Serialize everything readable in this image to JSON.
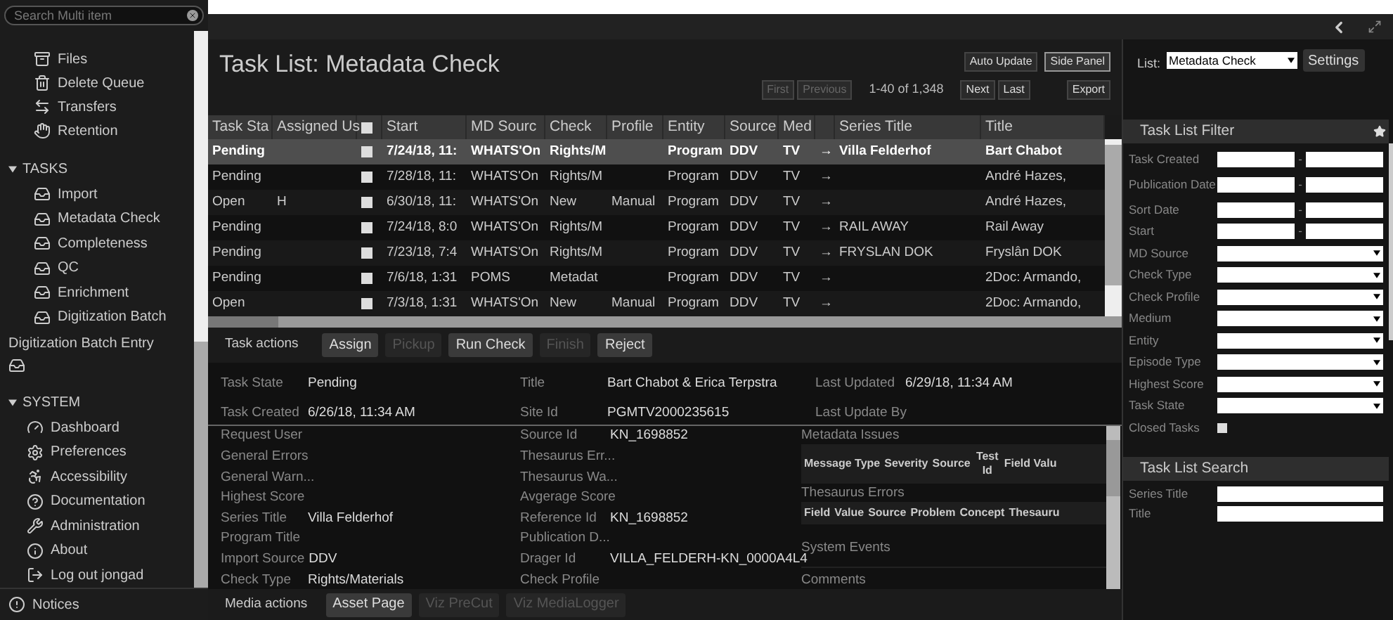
{
  "sidebar": {
    "search": {
      "placeholder": "Search Multi item"
    },
    "top_items": [
      {
        "label": "Files"
      },
      {
        "label": "Delete Queue"
      },
      {
        "label": "Transfers"
      },
      {
        "label": "Retention"
      }
    ],
    "sections": [
      {
        "title": "TASKS",
        "expanded": true,
        "items": [
          {
            "label": "Import"
          },
          {
            "label": "Metadata Check"
          },
          {
            "label": "Completeness"
          },
          {
            "label": "QC"
          },
          {
            "label": "Enrichment"
          },
          {
            "label": "Digitization Batch"
          },
          {
            "label": "Digitization Batch Entry"
          }
        ]
      },
      {
        "title": "SYSTEM",
        "expanded": true,
        "items": [
          {
            "label": "Dashboard"
          },
          {
            "label": "Preferences"
          },
          {
            "label": "Accessibility"
          },
          {
            "label": "Documentation"
          },
          {
            "label": "Administration"
          },
          {
            "label": "About"
          },
          {
            "label": "Log out jongad"
          }
        ]
      }
    ],
    "notices": "Notices"
  },
  "page": {
    "title": "Task List: Metadata Check",
    "toggles": [
      {
        "label": "Auto Update",
        "selected": false
      },
      {
        "label": "Side Panel",
        "selected": true
      }
    ],
    "pager": {
      "first": {
        "label": "First",
        "disabled": true
      },
      "previous": {
        "label": "Previous",
        "disabled": true
      },
      "range": "1-40 of 1,348",
      "next": {
        "label": "Next",
        "disabled": false
      },
      "last": {
        "label": "Last",
        "disabled": false
      },
      "export": "Export"
    }
  },
  "table": {
    "columns": [
      {
        "kind": "text",
        "label": "Task Sta"
      },
      {
        "kind": "text",
        "label": "Assigned Us"
      },
      {
        "kind": "checkbox",
        "checked": false
      },
      {
        "kind": "text",
        "label": "Start"
      },
      {
        "kind": "text",
        "label": "MD Sourc"
      },
      {
        "kind": "text",
        "label": "Check"
      },
      {
        "kind": "text",
        "label": "Profile"
      },
      {
        "kind": "text",
        "label": "Entity"
      },
      {
        "kind": "text",
        "label": "Source"
      },
      {
        "kind": "text",
        "label": "Med"
      },
      {
        "kind": "arrow"
      },
      {
        "kind": "text",
        "label": "Series Title"
      },
      {
        "kind": "text",
        "label": "Title"
      }
    ],
    "rows": [
      {
        "selected": true,
        "cells": [
          "Pending",
          null,
          {
            "checked": false
          },
          "7/24/18, 11:",
          "WHATS'On",
          "Rights/M",
          null,
          "Program",
          "DDV",
          "TV",
          "→",
          "Villa Felderhof",
          "Bart Chabot"
        ]
      },
      {
        "selected": false,
        "cells": [
          "Pending",
          null,
          {
            "checked": false
          },
          "7/28/18, 11:",
          "WHATS'On",
          "Rights/M",
          null,
          "Program",
          "DDV",
          "TV",
          "→",
          null,
          "André Hazes,"
        ]
      },
      {
        "selected": false,
        "cells": [
          "Open",
          "H",
          {
            "checked": false
          },
          "6/30/18, 11:",
          "WHATS'On",
          "New",
          "Manual",
          "Program",
          "DDV",
          "TV",
          "→",
          null,
          "André Hazes,"
        ]
      },
      {
        "selected": false,
        "cells": [
          "Pending",
          null,
          {
            "checked": false
          },
          "7/24/18, 8:0",
          "WHATS'On",
          "Rights/M",
          null,
          "Program",
          "DDV",
          "TV",
          "→",
          "RAIL AWAY",
          "Rail Away"
        ]
      },
      {
        "selected": false,
        "cells": [
          "Pending",
          null,
          {
            "checked": false
          },
          "7/23/18, 7:4",
          "WHATS'On",
          "Rights/M",
          null,
          "Program",
          "DDV",
          "TV",
          "→",
          "FRYSLAN DOK",
          "Fryslân DOK"
        ]
      },
      {
        "selected": false,
        "cells": [
          "Pending",
          null,
          {
            "checked": false
          },
          "7/6/18, 1:31",
          "POMS",
          "Metadat",
          null,
          "Program",
          "DDV",
          "TV",
          "→",
          null,
          "2Doc: Armando,"
        ]
      },
      {
        "selected": false,
        "cells": [
          "Open",
          null,
          {
            "checked": false
          },
          "7/3/18, 1:31",
          "WHATS'On",
          "New",
          "Manual",
          "Program",
          "DDV",
          "TV",
          "→",
          null,
          "2Doc: Armando,"
        ]
      }
    ]
  },
  "task_actions": {
    "label": "Task actions",
    "buttons": [
      {
        "label": "Assign",
        "disabled": false
      },
      {
        "label": "Pickup",
        "disabled": true
      },
      {
        "label": "Run Check",
        "disabled": false
      },
      {
        "label": "Finish",
        "disabled": true
      },
      {
        "label": "Reject",
        "disabled": false
      }
    ]
  },
  "details": {
    "summary": [
      {
        "label": "Task State",
        "value": "Pending"
      },
      {
        "label": "Title",
        "value": "Bart Chabot & Erica Terpstra"
      },
      {
        "label": "Last Updated",
        "value": "6/29/18, 11:34 AM"
      },
      {
        "label": "Task Created",
        "value": "6/26/18, 11:34 AM"
      },
      {
        "label": "Site Id",
        "value": "PGMTV2000235615"
      },
      {
        "label": "Last Update By"
      }
    ],
    "left_fields": [
      {
        "label": "Request User"
      },
      {
        "label": "General Errors"
      },
      {
        "label": "General Warn..."
      },
      {
        "label": "Highest Score"
      },
      {
        "label": "Series Title",
        "value": "Villa Felderhof"
      },
      {
        "label": "Program Title"
      },
      {
        "label": "Import Source",
        "value": "DDV"
      },
      {
        "label": "Check Type",
        "value": "Rights/Materials"
      }
    ],
    "middle_fields": [
      {
        "label": "Source Id",
        "value": "KN_1698852"
      },
      {
        "label": "Thesaurus Err..."
      },
      {
        "label": "Thesaurus Wa..."
      },
      {
        "label": "Avgerage Score"
      },
      {
        "label": "Reference Id",
        "value": "KN_1698852"
      },
      {
        "label": "Publication D..."
      },
      {
        "label": "Drager Id",
        "value": "VILLA_FELDERH-KN_0000A4L4"
      },
      {
        "label": "Check Profile"
      }
    ],
    "issues": [
      {
        "title": "Metadata Issues",
        "columns": [
          "Message Type",
          "Severity",
          "Source",
          "Test Id",
          "Field Valu"
        ]
      },
      {
        "title": "Thesaurus Errors",
        "columns": [
          "Field",
          "Value",
          "Source",
          "Problem",
          "Concept",
          "Thesauru"
        ]
      },
      {
        "title": "System Events"
      },
      {
        "title": "Comments"
      }
    ]
  },
  "media_actions": {
    "label": "Media actions",
    "buttons": [
      {
        "label": "Asset Page",
        "disabled": false
      },
      {
        "label": "Viz PreCut",
        "disabled": true
      },
      {
        "label": "Viz MediaLogger",
        "disabled": true
      }
    ]
  },
  "side_panel": {
    "list_label": "List:",
    "list_value": "Metadata Check",
    "settings": "Settings",
    "filter": {
      "title": "Task List Filter",
      "fields": [
        {
          "kind": "date_range",
          "label": "Task Created",
          "separator": "-"
        },
        {
          "kind": "date_range",
          "label": "Publication Date",
          "separator": "-"
        },
        {
          "kind": "date_range",
          "label": "Sort Date",
          "separator": "-"
        },
        {
          "kind": "date_range",
          "label": "Start",
          "separator": "-"
        },
        {
          "kind": "select",
          "label": "MD Source"
        },
        {
          "kind": "select",
          "label": "Check Type"
        },
        {
          "kind": "select",
          "label": "Check Profile"
        },
        {
          "kind": "select",
          "label": "Medium"
        },
        {
          "kind": "select",
          "label": "Entity"
        },
        {
          "kind": "select",
          "label": "Episode Type"
        },
        {
          "kind": "select",
          "label": "Highest Score"
        },
        {
          "kind": "select",
          "label": "Task State"
        },
        {
          "kind": "checkbox",
          "label": "Closed Tasks",
          "checked": false
        }
      ]
    },
    "search": {
      "title": "Task List Search",
      "fields": [
        {
          "label": "Series Title"
        },
        {
          "label": "Title"
        }
      ]
    }
  }
}
